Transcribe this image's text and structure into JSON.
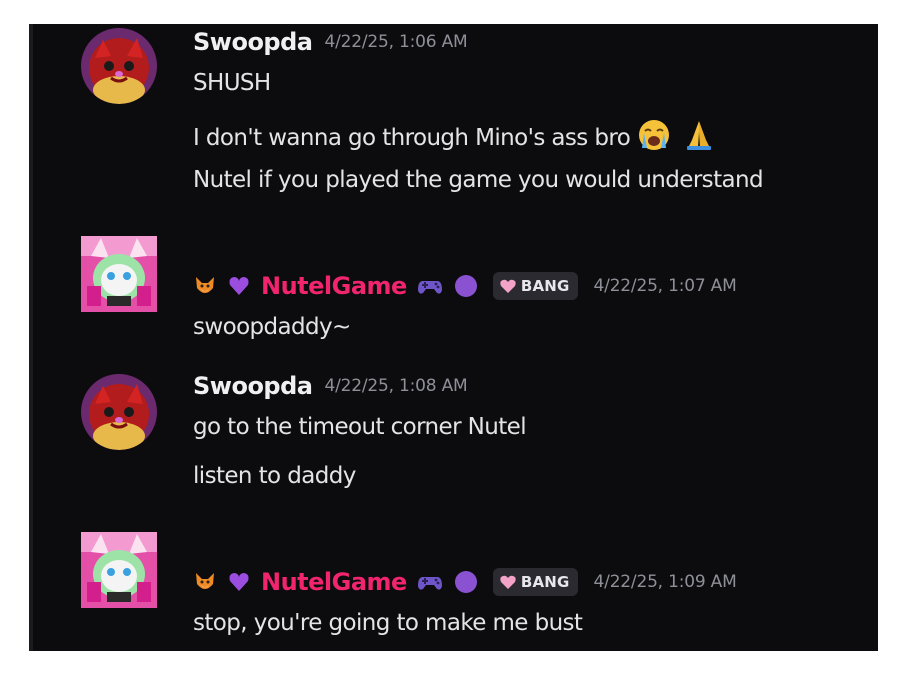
{
  "messages": [
    {
      "author": "Swoopda",
      "timestamp": "4/22/25, 1:06 AM",
      "lines": [
        "SHUSH",
        "I don't wanna go through Mino's ass bro",
        "Nutel if you played the game you would understand"
      ],
      "emojis": [
        "loudly-crying-face-emoji",
        "folded-hands-emoji"
      ]
    },
    {
      "author": "NutelGame",
      "timestamp": "4/22/25, 1:07 AM",
      "tag": "BANG",
      "lines": [
        "swoopdaddy~"
      ]
    },
    {
      "author": "Swoopda",
      "timestamp": "4/22/25, 1:08 AM",
      "lines": [
        "go to the timeout corner Nutel",
        "listen to daddy"
      ]
    },
    {
      "author": "NutelGame",
      "timestamp": "4/22/25, 1:09 AM",
      "tag": "BANG",
      "lines": [
        "stop, you're going to make me bust"
      ]
    }
  ],
  "colors": {
    "background": "#0c0c0f",
    "username_default": "#f0f0f2",
    "username_role": "#f0256e",
    "timestamp": "#8f9097",
    "message_text": "#e4e4e7",
    "tag_background": "#2a2a30"
  },
  "icons": {
    "name_prefix": [
      "fox-icon",
      "purple-heart-icon"
    ],
    "name_suffix": [
      "game-controller-icon",
      "purple-circle-icon"
    ],
    "tag_icon": "heart-icon"
  }
}
